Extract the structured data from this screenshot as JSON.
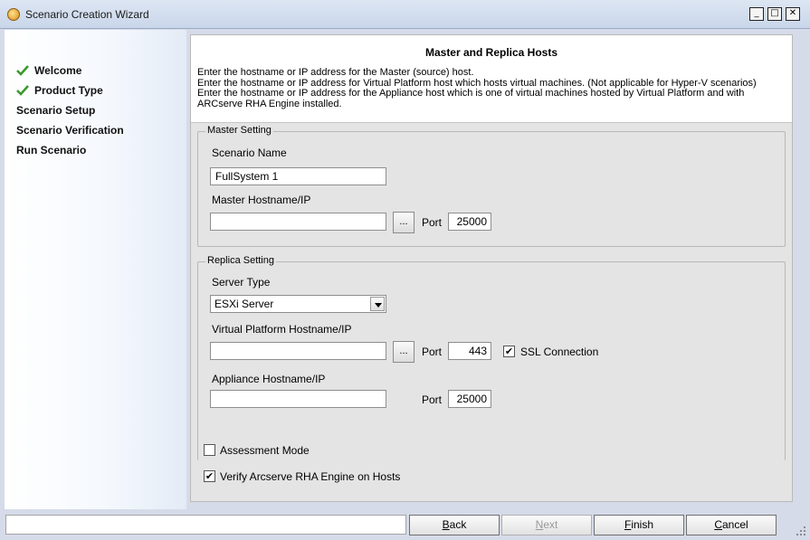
{
  "window": {
    "title": "Scenario Creation Wizard",
    "min_glyph": "_",
    "max_glyph": "□",
    "close_glyph": "✕"
  },
  "sidebar": {
    "items": [
      {
        "label": "Welcome",
        "done": true
      },
      {
        "label": "Product Type",
        "done": true
      },
      {
        "label": "Scenario Setup",
        "done": false
      },
      {
        "label": "Scenario Verification",
        "done": false
      },
      {
        "label": "Run Scenario",
        "done": false
      }
    ]
  },
  "header": {
    "title": "Master and Replica Hosts",
    "lines": [
      "Enter the hostname or IP address for the Master (source) host.",
      "Enter the hostname or IP address for Virtual Platform host which hosts virtual machines. (Not applicable for Hyper-V scenarios)",
      "Enter the hostname or IP address for the Appliance host which is one of virtual machines hosted by Virtual Platform and with ARCserve RHA Engine installed."
    ]
  },
  "master": {
    "legend": "Master Setting",
    "scenario_name_label": "Scenario Name",
    "scenario_name_value": "FullSystem 1",
    "hostname_label": "Master Hostname/IP",
    "hostname_value": "",
    "browse_label": "...",
    "port_label": "Port",
    "port_value": "25000"
  },
  "replica": {
    "legend": "Replica Setting",
    "server_type_label": "Server Type",
    "server_type_value": "ESXi Server",
    "vp_label": "Virtual Platform Hostname/IP",
    "vp_value": "",
    "browse_label": "...",
    "vp_port_label": "Port",
    "vp_port_value": "443",
    "ssl_label": "SSL Connection",
    "ssl_checked": true,
    "appliance_label": "Appliance Hostname/IP",
    "appliance_value": "",
    "appliance_port_label": "Port",
    "appliance_port_value": "25000"
  },
  "options": {
    "assessment_label": "Assessment Mode",
    "assessment_checked": false,
    "verify_label": "Verify Arcserve RHA Engine on Hosts",
    "verify_checked": true
  },
  "buttons": {
    "back": {
      "mnemonic": "B",
      "rest": "ack"
    },
    "next": {
      "mnemonic": "N",
      "rest": "ext"
    },
    "finish": {
      "mnemonic": "F",
      "rest": "inish"
    },
    "cancel": {
      "mnemonic": "C",
      "rest": "ancel"
    }
  },
  "status_text": "",
  "colors": {
    "check_green": "#3a9a2c",
    "sidebar_bg": "#f4f8fd",
    "panel_bg": "#e4e4e4"
  }
}
